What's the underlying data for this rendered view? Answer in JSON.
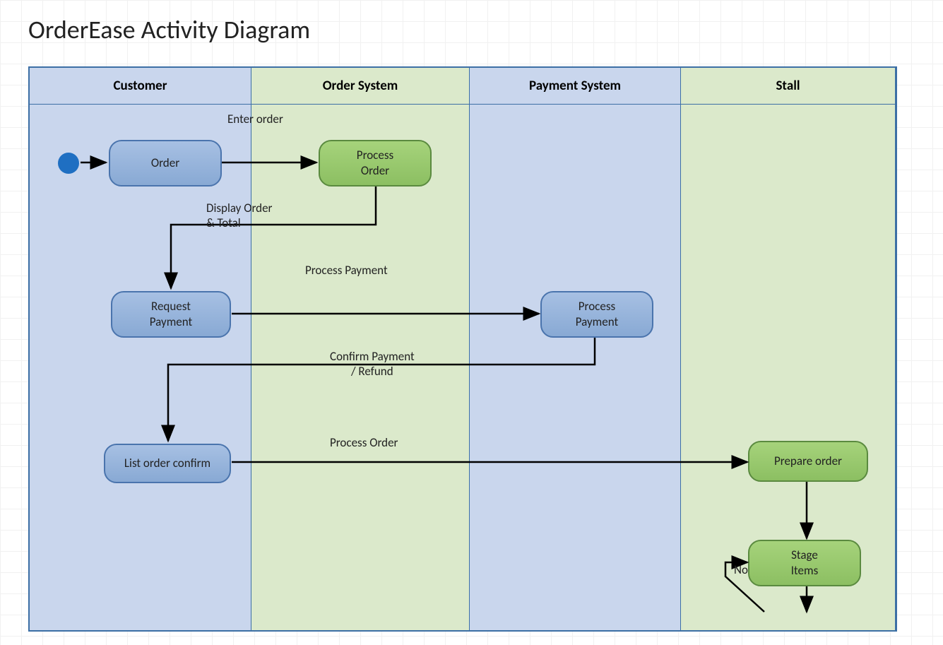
{
  "title": "OrderEase Activity Diagram",
  "lanes": {
    "customer": "Customer",
    "ordersys": "Order System",
    "paymentsys": "Payment System",
    "stall": "Stall"
  },
  "nodes": {
    "order": "Order",
    "process_order": "Process\nOrder",
    "request_payment": "Request\nPayment",
    "process_payment": "Process\nPayment",
    "list_order_confirm": "List order confirm",
    "prepare_order": "Prepare order",
    "stage_items": "Stage\nItems"
  },
  "edges": {
    "enter_order": "Enter order",
    "display_order_total": "Display Order\n& Total",
    "process_payment_lbl": "Process Payment",
    "confirm_payment_refund": "Confirm Payment\n/ Refund",
    "process_order_lbl": "Process Order",
    "no": "No"
  }
}
